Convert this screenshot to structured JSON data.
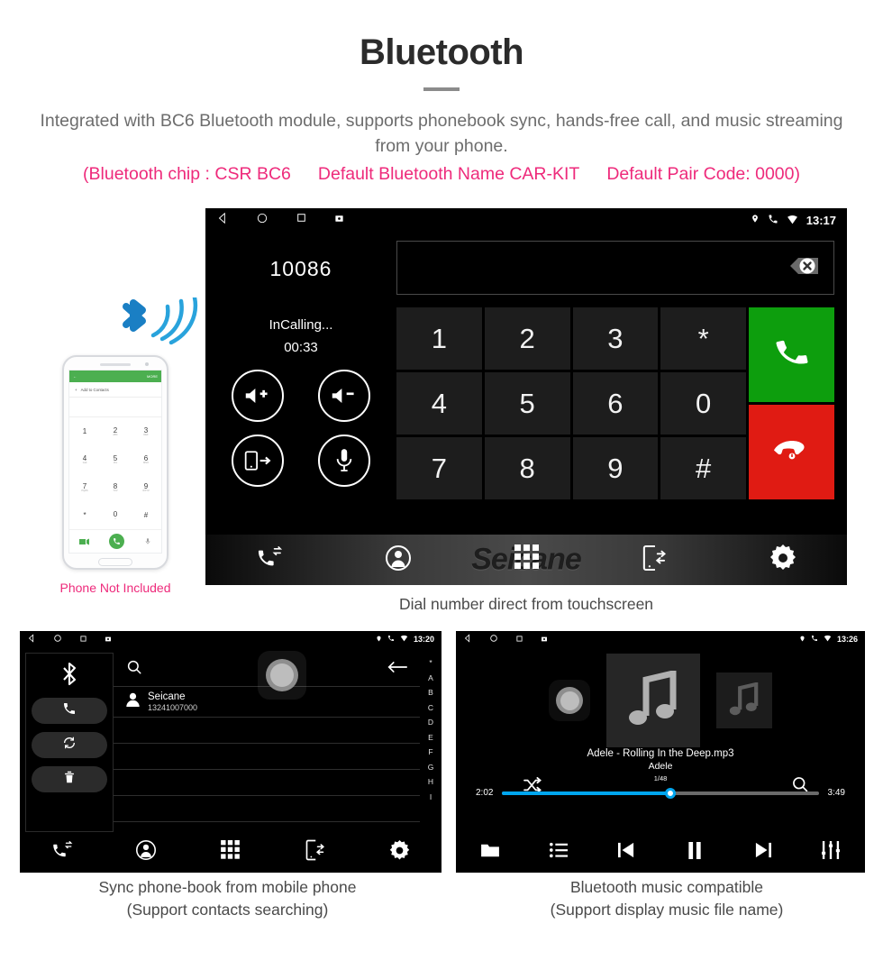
{
  "header": {
    "title": "Bluetooth",
    "subtitle": "Integrated with BC6 Bluetooth module, supports phonebook sync, hands-free call, and music streaming from your phone.",
    "accent": [
      "(Bluetooth chip : CSR BC6",
      "Default Bluetooth Name CAR-KIT",
      "Default Pair Code: 0000)"
    ],
    "accent_color": "#ee2a7b"
  },
  "phone_mockup": {
    "caption": "Phone Not Included",
    "app_header_more": "MORE",
    "add_contacts": "Add to Contacts",
    "keys": [
      {
        "d": "1",
        "s": ""
      },
      {
        "d": "2",
        "s": "ABC"
      },
      {
        "d": "3",
        "s": "DEF"
      },
      {
        "d": "4",
        "s": "GHI"
      },
      {
        "d": "5",
        "s": "JKL"
      },
      {
        "d": "6",
        "s": "MNO"
      },
      {
        "d": "7",
        "s": "PQRS"
      },
      {
        "d": "8",
        "s": "TUV"
      },
      {
        "d": "9",
        "s": "WXYZ"
      },
      {
        "d": "*",
        "s": ""
      },
      {
        "d": "0",
        "s": "+"
      },
      {
        "d": "#",
        "s": ""
      }
    ]
  },
  "dialer_screen": {
    "statusbar": {
      "time": "13:17"
    },
    "number": "10086",
    "call_state": "InCalling...",
    "call_timer": "00:33",
    "input_value": "",
    "input_placeholder": "",
    "controls": [
      "volume-up-icon",
      "volume-down-icon",
      "transfer-to-phone-icon",
      "microphone-icon"
    ],
    "keypad": [
      "1",
      "2",
      "3",
      "*",
      "4",
      "5",
      "6",
      "0",
      "7",
      "8",
      "9",
      "#"
    ],
    "call_button": "call-icon",
    "hangup_button": "hangup-icon",
    "clear_button": "backspace-icon",
    "watermark": "Seicane",
    "caption": "Dial number direct from touchscreen"
  },
  "phonebook_screen": {
    "statusbar": {
      "time": "13:20"
    },
    "sidebar": [
      "bluetooth-icon",
      "call-icon",
      "sync-icon",
      "delete-icon"
    ],
    "search_placeholder": "",
    "contact": {
      "name": "Seicane",
      "number": "13241007000"
    },
    "alphabet": [
      "*",
      "A",
      "B",
      "C",
      "D",
      "E",
      "F",
      "G",
      "H",
      "I"
    ],
    "caption_line1": "Sync phone-book from mobile phone",
    "caption_line2": "(Support contacts searching)"
  },
  "music_screen": {
    "statusbar": {
      "time": "13:26"
    },
    "title": "Adele - Rolling In the Deep.mp3",
    "artist": "Adele",
    "track_index": "1/48",
    "elapsed": "2:02",
    "duration": "3:49",
    "progress_percent": 53,
    "progress_color": "#00a6ef",
    "transport": [
      "folder-icon",
      "playlist-icon",
      "previous-icon",
      "pause-icon",
      "next-icon",
      "equalizer-icon"
    ],
    "caption_line1": "Bluetooth music compatible",
    "caption_line2": "(Support display music file name)"
  },
  "navbar": {
    "items": [
      "call-history-icon",
      "contacts-icon",
      "keypad-icon",
      "phone-sync-icon",
      "settings-icon"
    ]
  }
}
